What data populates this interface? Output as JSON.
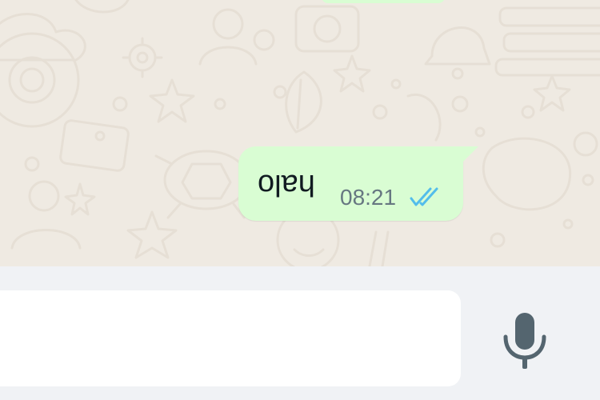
{
  "conversation": {
    "messages": [
      {
        "direction": "outgoing",
        "text": "halo",
        "time": "08:21",
        "status_icon": "double-check-read-icon"
      }
    ]
  },
  "composer": {
    "input_value": "",
    "mic_icon": "microphone-icon"
  },
  "colors": {
    "chat_background": "#efeae2",
    "outgoing_bubble": "#d9fdd3",
    "composer_background": "#f0f2f5",
    "read_tick": "#53bdeb",
    "mic_icon": "#54656f"
  }
}
